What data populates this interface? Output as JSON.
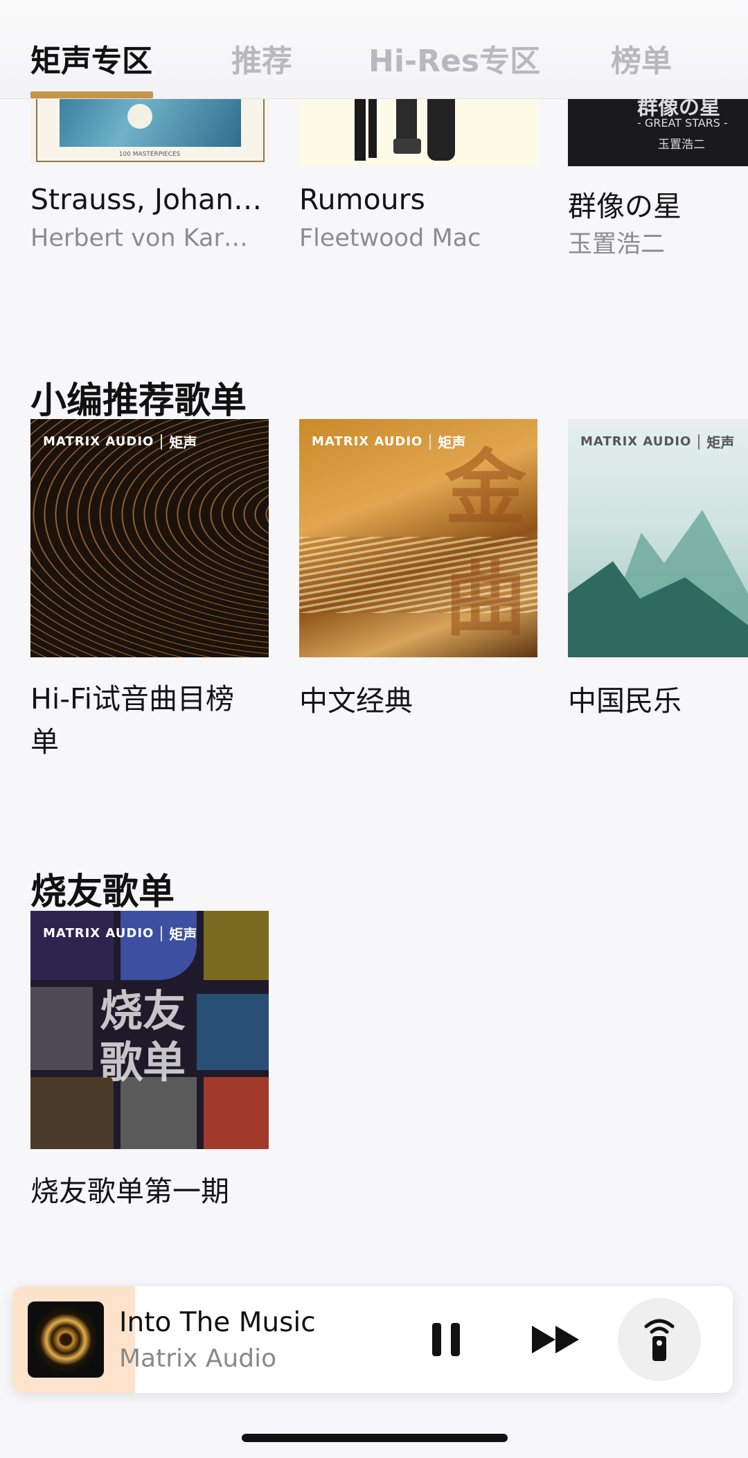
{
  "tabs": [
    {
      "label": "矩声专区",
      "active": true
    },
    {
      "label": "推荐",
      "active": false
    },
    {
      "label": "Hi-Res专区",
      "active": false
    },
    {
      "label": "榜单",
      "active": false
    }
  ],
  "top_albums": [
    {
      "title": "Strauss, Johann II…",
      "artist": "Herbert von Karajan…",
      "art_text": "100 MASTERPIECES"
    },
    {
      "title": "Rumours",
      "artist": "Fleetwood Mac"
    },
    {
      "title": "群像の星",
      "artist": "玉置浩二",
      "art_text": "群像の星",
      "art_sub": "- GREAT STARS -",
      "art_name": "玉置浩二"
    }
  ],
  "editor_section": {
    "title": "小编推荐歌单",
    "playlists": [
      {
        "title": "Hi-Fi试音曲目榜单",
        "brand": "矩声",
        "logo": "MATRIX AUDIO"
      },
      {
        "title": "中文经典",
        "brand": "矩声",
        "logo": "MATRIX AUDIO",
        "art_text": "金曲"
      },
      {
        "title": "中国民乐",
        "brand": "矩声",
        "logo": "MATRIX AUDIO"
      }
    ]
  },
  "fans_section": {
    "title": "烧友歌单",
    "playlists": [
      {
        "title": "烧友歌单第一期",
        "brand": "矩声",
        "logo": "MATRIX AUDIO",
        "art_text_1": "烧友",
        "art_text_2": "歌单"
      }
    ]
  },
  "now_playing": {
    "title": "Into The Music",
    "artist": "Matrix Audio",
    "progress": 0.17
  },
  "colors": {
    "accent": "#c9934a",
    "progress_fill": "#fde3cb",
    "background": "#f7f6f9"
  },
  "icons": [
    "pause-icon",
    "next-icon",
    "remote-control-icon"
  ]
}
